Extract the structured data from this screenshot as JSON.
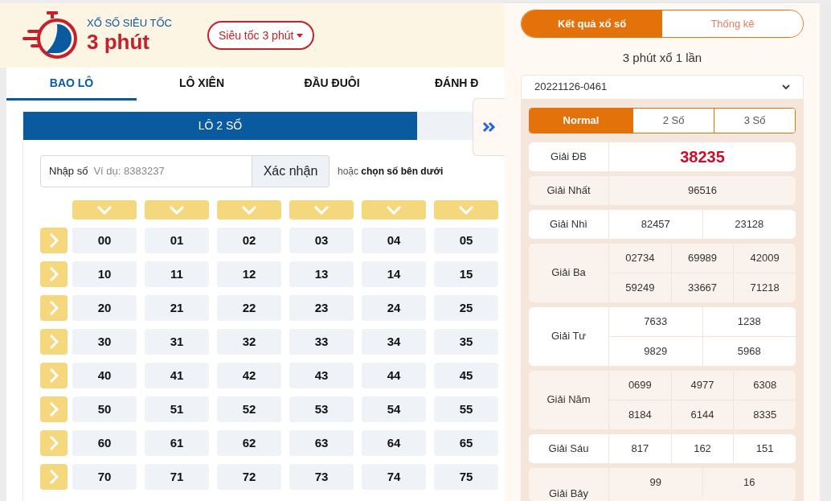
{
  "header": {
    "logo_caption": "XỔ SỐ SIÊU TỐC",
    "logo_title": "3 phút",
    "mode_dropdown": "Siêu tốc 3 phút"
  },
  "tabs": [
    {
      "label": "BAO LÔ",
      "selected": true
    },
    {
      "label": "LÔ XIÊN",
      "selected": false
    },
    {
      "label": "ĐẦU ĐUÔI",
      "selected": false
    },
    {
      "label": "ĐÁNH Đ",
      "selected": false
    }
  ],
  "subtab": {
    "label": "LÔ 2 SỐ",
    "selected": true
  },
  "entry": {
    "label": "Nhập số",
    "placeholder": "Ví dụ: 8383237",
    "button": "Xác nhận",
    "hint": "hoặc **chọn số bên dưới**"
  },
  "grid": [
    [
      "00",
      "01",
      "02",
      "03",
      "04",
      "05"
    ],
    [
      "10",
      "11",
      "12",
      "13",
      "14",
      "15"
    ],
    [
      "20",
      "21",
      "22",
      "23",
      "24",
      "25"
    ],
    [
      "30",
      "31",
      "32",
      "33",
      "34",
      "35"
    ],
    [
      "40",
      "41",
      "42",
      "43",
      "44",
      "45"
    ],
    [
      "50",
      "51",
      "52",
      "53",
      "54",
      "55"
    ],
    [
      "60",
      "61",
      "62",
      "63",
      "64",
      "65"
    ],
    [
      "70",
      "71",
      "72",
      "73",
      "74",
      "75"
    ]
  ],
  "results_panel": {
    "tabs": [
      {
        "label": "Kết quả xổ số",
        "selected": true
      },
      {
        "label": "Thống kê",
        "selected": false
      }
    ],
    "title": "3 phút xổ 1 lần",
    "draw_select": "20221126-0461",
    "modes": [
      {
        "label": "Normal",
        "selected": true
      },
      {
        "label": "2 Số",
        "selected": false
      },
      {
        "label": "3 Số",
        "selected": false
      }
    ],
    "prizes": [
      {
        "label": "Giải ĐB",
        "kind": "special",
        "numbers": [
          "38235"
        ]
      },
      {
        "label": "Giải Nhất",
        "kind": "normal",
        "numbers": [
          "96516"
        ]
      },
      {
        "label": "Giải Nhì",
        "kind": "normal",
        "numbers": [
          "82457",
          "23128"
        ]
      },
      {
        "label": "Giải Ba",
        "kind": "normal",
        "numbers": [
          "02734",
          "69989",
          "42009",
          "59249",
          "33667",
          "71218"
        ]
      },
      {
        "label": "Giải Tư",
        "kind": "normal",
        "numbers": [
          "7633",
          "1238",
          "9829",
          "5968"
        ]
      },
      {
        "label": "Giải Năm",
        "kind": "normal",
        "numbers": [
          "0699",
          "4977",
          "6308",
          "8184",
          "6144",
          "8335"
        ]
      },
      {
        "label": "Giải Sáu",
        "kind": "normal",
        "numbers": [
          "817",
          "162",
          "151"
        ]
      },
      {
        "label": "Giải Bảy",
        "kind": "normal",
        "numbers": [
          "99",
          "16"
        ]
      }
    ]
  }
}
